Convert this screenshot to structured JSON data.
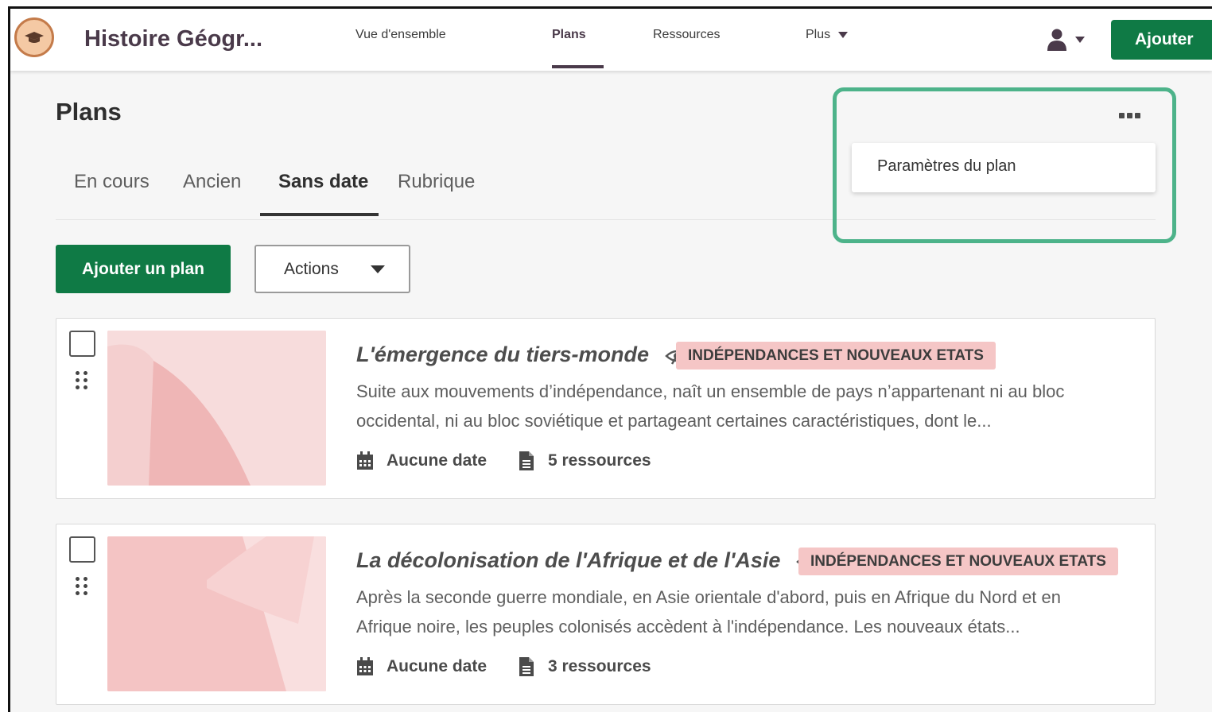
{
  "header": {
    "app_title": "Histoire Géogr...",
    "nav": [
      {
        "label": "Vue d'ensemble"
      },
      {
        "label": "Plans"
      },
      {
        "label": "Ressources"
      },
      {
        "label": "Plus"
      }
    ],
    "add_label": "Ajouter",
    "logo_icon": "graduation-cap-icon",
    "user_icon": "user-icon"
  },
  "main": {
    "title": "Plans",
    "tabs": [
      {
        "label": "En cours"
      },
      {
        "label": "Ancien"
      },
      {
        "label": "Sans date"
      },
      {
        "label": "Rubrique"
      }
    ],
    "active_tab": "Sans date",
    "add_plan_label": "Ajouter un plan",
    "actions_label": "Actions"
  },
  "menu": {
    "items": [
      {
        "label": "Paramètres du plan"
      }
    ]
  },
  "plans": [
    {
      "title": "L'émergence du tiers-monde",
      "tag": "INDÉPENDANCES ET NOUVEAUX ETATS",
      "description": "Suite aux mouvements d’indépendance, naît un ensemble de pays n’appartenant ni au bloc occidental, ni au bloc soviétique et partageant certaines caractéristiques, dont le...",
      "date": "Aucune date",
      "resources": "5 ressources"
    },
    {
      "title": "La décolonisation de l'Afrique et de l'Asie",
      "tag": "INDÉPENDANCES ET NOUVEAUX ETATS",
      "description": "Après la seconde guerre mondiale, en Asie orientale d'abord, puis en Afrique du Nord et en Afrique noire, les peuples colonisés accèdent à l'indépendance. Les nouveaux états...",
      "date": "Aucune date",
      "resources": "3 ressources"
    }
  ],
  "colors": {
    "primary_green": "#0f7a45",
    "tag_pink": "#f5c6c6",
    "highlight": "#4db38a",
    "brand_dark": "#4a3a4a"
  }
}
